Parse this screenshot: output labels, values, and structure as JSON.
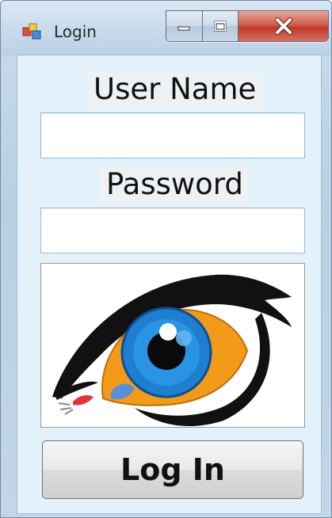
{
  "window": {
    "title": "Login",
    "controls": {
      "minimize": "minimize",
      "maximize": "maximize",
      "close": "close"
    }
  },
  "form": {
    "username_label": "User Name",
    "username_value": "",
    "password_label": "Password",
    "password_value": "",
    "login_label": "Log In"
  },
  "icons": {
    "app": "app-icon",
    "picture": "eye-logo"
  },
  "colors": {
    "client_bg": "#e3f1fb",
    "iris": "#1e7fd0",
    "iris_ring": "#f29a1a",
    "close_button": "#c8402f"
  }
}
